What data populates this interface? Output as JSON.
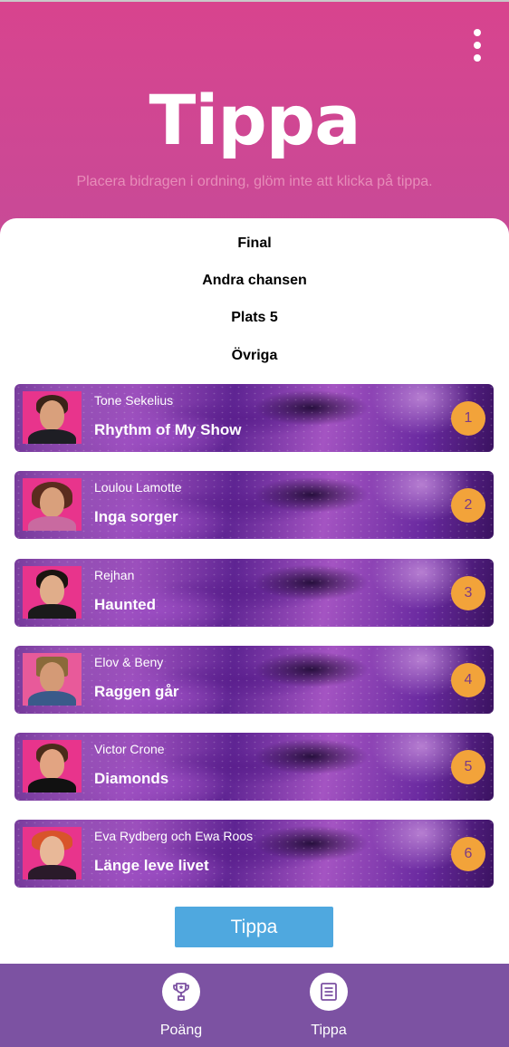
{
  "header": {
    "title": "Tippa",
    "subtitle": "Placera bidragen i ordning, glöm inte att klicka på tippa.",
    "menu_icon": "more-vertical-icon"
  },
  "categories": [
    "Final",
    "Andra chansen",
    "Plats 5",
    "Övriga"
  ],
  "entries": [
    {
      "artist": "Tone Sekelius",
      "song": "Rhythm of My Show",
      "rank": "1"
    },
    {
      "artist": "Loulou Lamotte",
      "song": "Inga sorger",
      "rank": "2"
    },
    {
      "artist": "Rejhan",
      "song": "Haunted",
      "rank": "3"
    },
    {
      "artist": "Elov & Beny",
      "song": "Raggen går",
      "rank": "4"
    },
    {
      "artist": "Victor Crone",
      "song": "Diamonds",
      "rank": "5"
    },
    {
      "artist": "Eva Rydberg och Ewa Roos",
      "song": "Länge leve livet",
      "rank": "6"
    }
  ],
  "submit_label": "Tippa",
  "nav": {
    "items": [
      {
        "label": "Poäng",
        "icon": "trophy-icon"
      },
      {
        "label": "Tippa",
        "icon": "list-icon"
      }
    ]
  },
  "colors": {
    "header_pink": "#d8448e",
    "rank_badge": "#f2a33a",
    "button_blue": "#4fa8df",
    "nav_purple": "#7c52a2"
  }
}
